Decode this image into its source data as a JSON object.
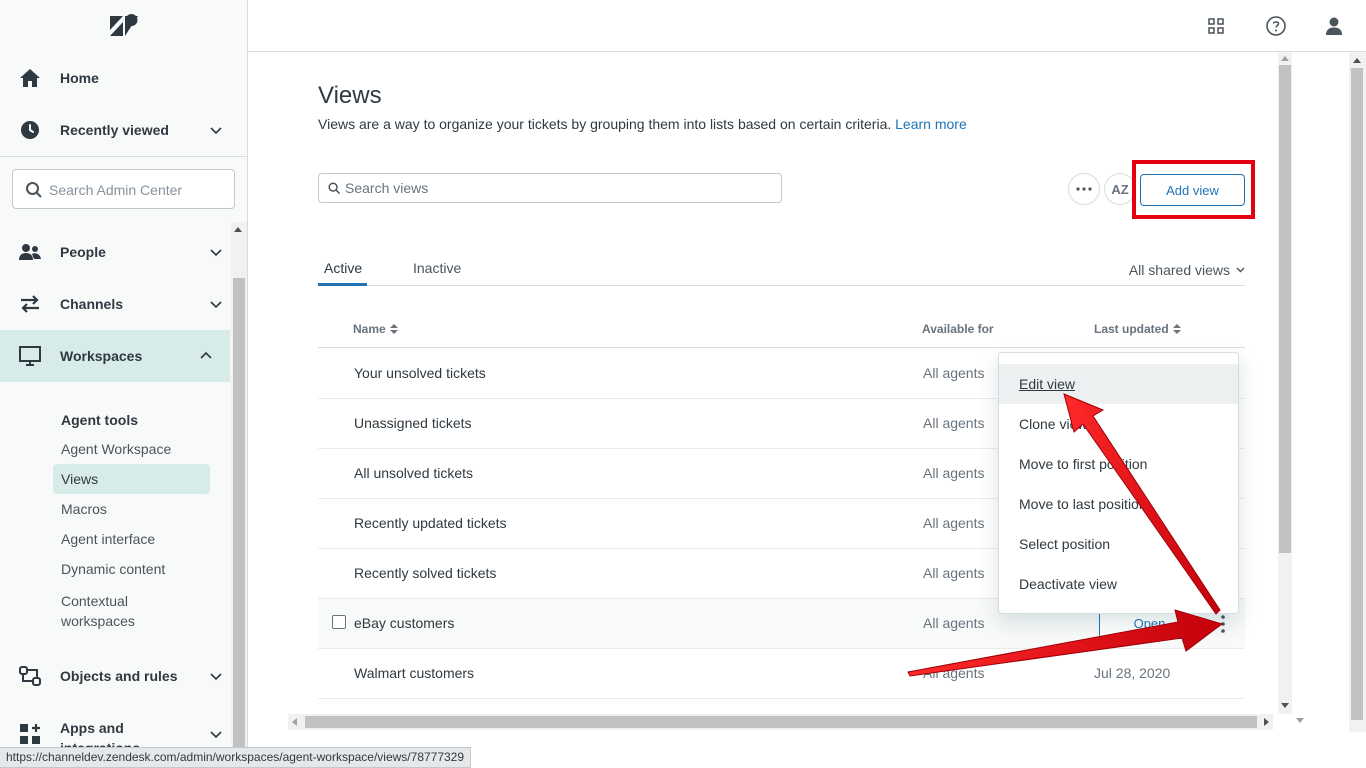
{
  "sidebar": {
    "nav_top": [
      {
        "label": "Home"
      },
      {
        "label": "Recently viewed"
      }
    ],
    "search": {
      "placeholder": "Search Admin Center"
    },
    "nav": [
      {
        "label": "People"
      },
      {
        "label": "Channels"
      },
      {
        "label": "Workspaces"
      },
      {
        "label": "Objects and rules"
      },
      {
        "label": "Apps and integrations"
      }
    ],
    "workspaces_sub": {
      "heading": "Agent tools",
      "items": [
        "Agent Workspace",
        "Views",
        "Macros",
        "Agent interface",
        "Dynamic content",
        "Contextual workspaces"
      ]
    }
  },
  "page": {
    "title": "Views",
    "description": "Views are a way to organize your tickets by grouping them into lists based on certain criteria.",
    "learn_more": "Learn more",
    "search_placeholder": "Search views",
    "add_view_label": "Add view",
    "sort_icon_text": "AZ",
    "tabs": [
      {
        "label": "Active"
      },
      {
        "label": "Inactive"
      }
    ],
    "filter_label": "All shared views",
    "columns": {
      "name": "Name",
      "available": "Available for",
      "updated": "Last updated"
    },
    "rows": [
      {
        "name": "Your unsolved tickets",
        "available": "All agents",
        "updated": ""
      },
      {
        "name": "Unassigned tickets",
        "available": "All agents",
        "updated": ""
      },
      {
        "name": "All unsolved tickets",
        "available": "All agents",
        "updated": ""
      },
      {
        "name": "Recently updated tickets",
        "available": "All agents",
        "updated": ""
      },
      {
        "name": "Recently solved tickets",
        "available": "All agents",
        "updated": ""
      },
      {
        "name": "eBay customers",
        "available": "All agents",
        "updated": ""
      },
      {
        "name": "Walmart customers",
        "available": "All agents",
        "updated": "Jul 28, 2020"
      }
    ],
    "open_label": "Open",
    "menu": [
      "Edit view",
      "Clone view",
      "Move to first position",
      "Move to last position",
      "Select position",
      "Deactivate view"
    ]
  },
  "status_url": "https://channeldev.zendesk.com/admin/workspaces/agent-workspace/views/78777329",
  "colors": {
    "accent": "#1f73b7",
    "highlight": "#e3000f",
    "active_nav": "#d7ece8"
  }
}
